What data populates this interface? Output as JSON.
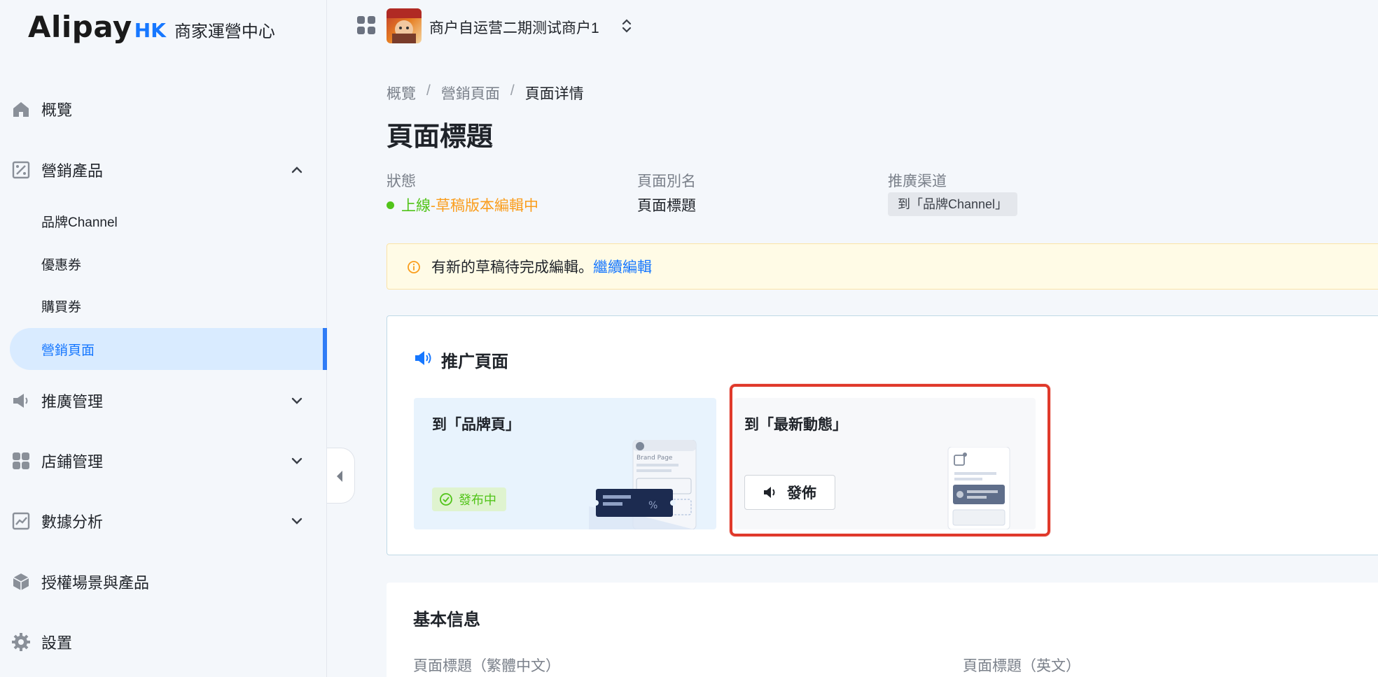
{
  "app": {
    "logo_text": "Alipay",
    "logo_suffix": "HK",
    "logo_subtitle": "商家運營中心"
  },
  "sidebar": {
    "items": [
      {
        "label": "概覽",
        "icon": "home-icon"
      },
      {
        "label": "營銷產品",
        "icon": "ticket-icon",
        "expanded": true
      },
      {
        "label": "推廣管理",
        "icon": "megaphone-icon",
        "expanded": false
      },
      {
        "label": "店鋪管理",
        "icon": "grid-icon",
        "expanded": false
      },
      {
        "label": "數據分析",
        "icon": "chart-icon",
        "expanded": false
      },
      {
        "label": "授權場景與產品",
        "icon": "cube-icon"
      },
      {
        "label": "設置",
        "icon": "gear-icon"
      }
    ],
    "subitems": [
      {
        "label": "品牌Channel"
      },
      {
        "label": "優惠券"
      },
      {
        "label": "購買券"
      },
      {
        "label": "營銷頁面",
        "active": true
      }
    ]
  },
  "topbar": {
    "merchant_name": "商户自运营二期测试商户1"
  },
  "breadcrumb": {
    "items": [
      "概覽",
      "營銷頁面",
      "頁面详情"
    ],
    "separator": "/"
  },
  "page": {
    "title": "頁面標題",
    "status_label": "狀態",
    "status_online": "上線",
    "status_sep": "-",
    "status_draft": "草稿版本編輯中",
    "alias_label": "頁面別名",
    "alias_value": "頁面標題",
    "channel_label": "推廣渠道",
    "channel_value": "到「品牌Channel」"
  },
  "alert": {
    "text": "有新的草稿待完成編輯。",
    "link": "繼續編輯"
  },
  "promo_card": {
    "title": "推广頁面",
    "brand": {
      "title": "到「品牌頁」",
      "badge": "發布中",
      "illustration_text": "Brand Page"
    },
    "news": {
      "title": "到「最新動態」",
      "button": "發佈"
    }
  },
  "basic_info": {
    "title": "基本信息",
    "field_zh": "頁面標題（繁體中文）",
    "field_en": "頁面標題（英文）"
  },
  "colors": {
    "accent": "#1677ff",
    "success": "#52c41a",
    "warning": "#fa9d1c",
    "highlight": "#e0392b"
  }
}
